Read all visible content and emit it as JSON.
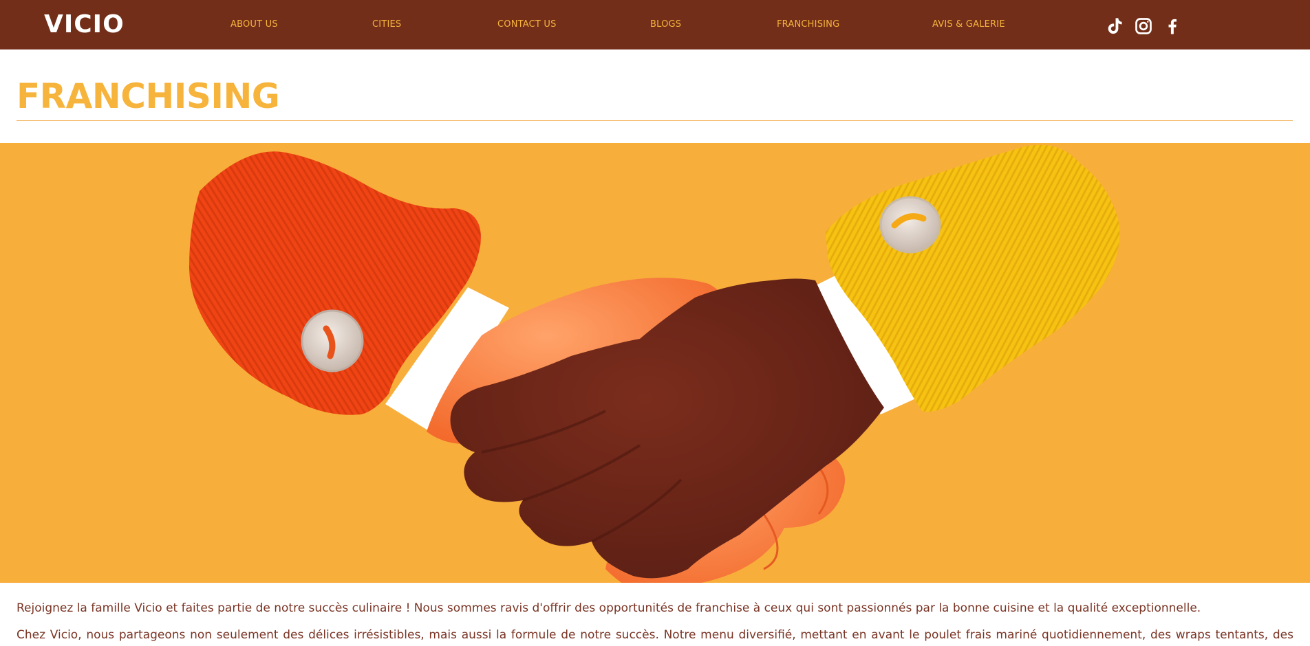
{
  "header": {
    "logo": "VICIO",
    "nav": [
      {
        "label": "ABOUT US"
      },
      {
        "label": "CITIES"
      },
      {
        "label": "CONTACT US"
      },
      {
        "label": "BLOGS"
      },
      {
        "label": "FRANCHISING"
      },
      {
        "label": "AVIS & GALERIE"
      }
    ],
    "social": [
      "tiktok-icon",
      "instagram-icon",
      "facebook-icon"
    ]
  },
  "page": {
    "title": "FRANCHISING"
  },
  "hero": {
    "image": "handshake-illustration",
    "background": "#f8ae3b"
  },
  "content": {
    "paragraphs": [
      "Rejoignez la famille Vicio et faites partie de notre succès culinaire ! Nous sommes ravis d'offrir des opportunités de franchise à ceux qui sont passionnés par la bonne cuisine et la qualité exceptionnelle.",
      "Chez Vicio, nous partageons non seulement des délices irrésistibles, mais aussi la formule de notre succès. Notre menu diversifié, mettant en avant le poulet frais mariné quotidiennement, des wraps tentants, des"
    ]
  },
  "colors": {
    "header_bg": "#722e18",
    "accent": "#f7b43c",
    "text": "#7a3424"
  }
}
